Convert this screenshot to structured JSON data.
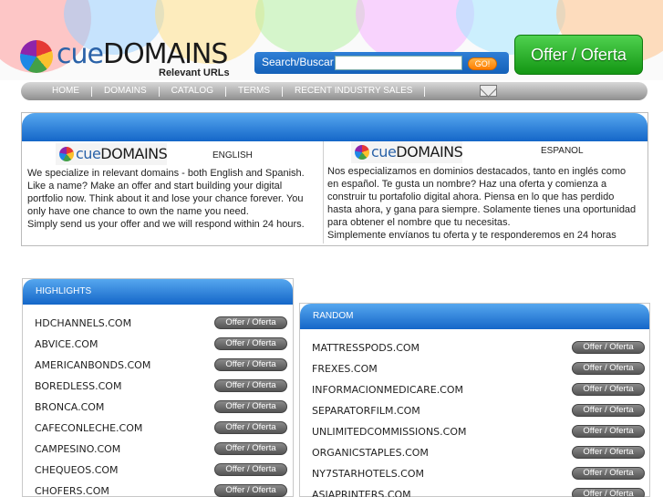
{
  "brand": {
    "logo_prefix": "cue",
    "logo_main": "DOMAINS",
    "tagline": "Relevant URLs"
  },
  "search": {
    "label": "Search/Buscar",
    "value": "",
    "placeholder": "",
    "go_label": "GO!"
  },
  "offer_button_label": "Offer / Oferta",
  "nav": {
    "items": [
      "HOME",
      "DOMAINS",
      "CATALOG",
      "TERMS",
      "RECENT INDUSTRY SALES"
    ],
    "mail_icon": "envelope-icon"
  },
  "intro": {
    "english": {
      "lang_label": "ENGLISH",
      "text": "We specialize in relevant domains - both English and Spanish. Like a name? Make an offer and start building your digital portfolio now. Think about it and lose your chance forever. You only have one chance to own the name you need.",
      "text2": "Simply send us your offer and we will respond within 24 hours."
    },
    "spanish": {
      "lang_label": "ESPANOL",
      "text": "Nos especializamos en dominios destacados, tanto en inglés como en español. Te gusta un nombre? Haz una oferta y comienza a construir tu portafolio digital ahora. Piensa en lo que has perdido hasta ahora, y gana para siempre. Solamente tienes una oportunidad para obtener el nombre que tu necesitas.",
      "text2": "Simplemente envíanos tu oferta y te responderemos en 24 horas"
    }
  },
  "highlights": {
    "title": "HIGHLIGHTS",
    "rows": [
      {
        "domain": "HDCHANNELS.COM",
        "offer": "Offer / Oferta"
      },
      {
        "domain": "ABVICE.COM",
        "offer": "Offer / Oferta"
      },
      {
        "domain": "AMERICANBONDS.COM",
        "offer": "Offer / Oferta"
      },
      {
        "domain": "BOREDLESS.COM",
        "offer": "Offer / Oferta"
      },
      {
        "domain": "BRONCA.COM",
        "offer": "Offer / Oferta"
      },
      {
        "domain": "CAFECONLECHE.COM",
        "offer": "Offer / Oferta"
      },
      {
        "domain": "CAMPESINO.COM",
        "offer": "Offer / Oferta"
      },
      {
        "domain": "CHEQUEOS.COM",
        "offer": "Offer / Oferta"
      },
      {
        "domain": "CHOFERS.COM",
        "offer": "Offer / Oferta"
      }
    ]
  },
  "random": {
    "title": "RANDOM",
    "rows": [
      {
        "domain": "MATTRESSPODS.COM",
        "offer": "Offer / Oferta"
      },
      {
        "domain": "FREXES.COM",
        "offer": "Offer / Oferta"
      },
      {
        "domain": "INFORMACIONMEDICARE.COM",
        "offer": "Offer / Oferta"
      },
      {
        "domain": "SEPARATORFILM.COM",
        "offer": "Offer / Oferta"
      },
      {
        "domain": "UNLIMITEDCOMMISSIONS.COM",
        "offer": "Offer / Oferta"
      },
      {
        "domain": "ORGANICSTAPLES.COM",
        "offer": "Offer / Oferta"
      },
      {
        "domain": "NY7STARHOTELS.COM",
        "offer": "Offer / Oferta"
      },
      {
        "domain": "ASIAPRINTERS.COM",
        "offer": "Offer / Oferta"
      }
    ]
  },
  "colors": {
    "accent_blue": "#1466c8",
    "offer_green": "#139613",
    "go_orange": "#ff7f00"
  }
}
